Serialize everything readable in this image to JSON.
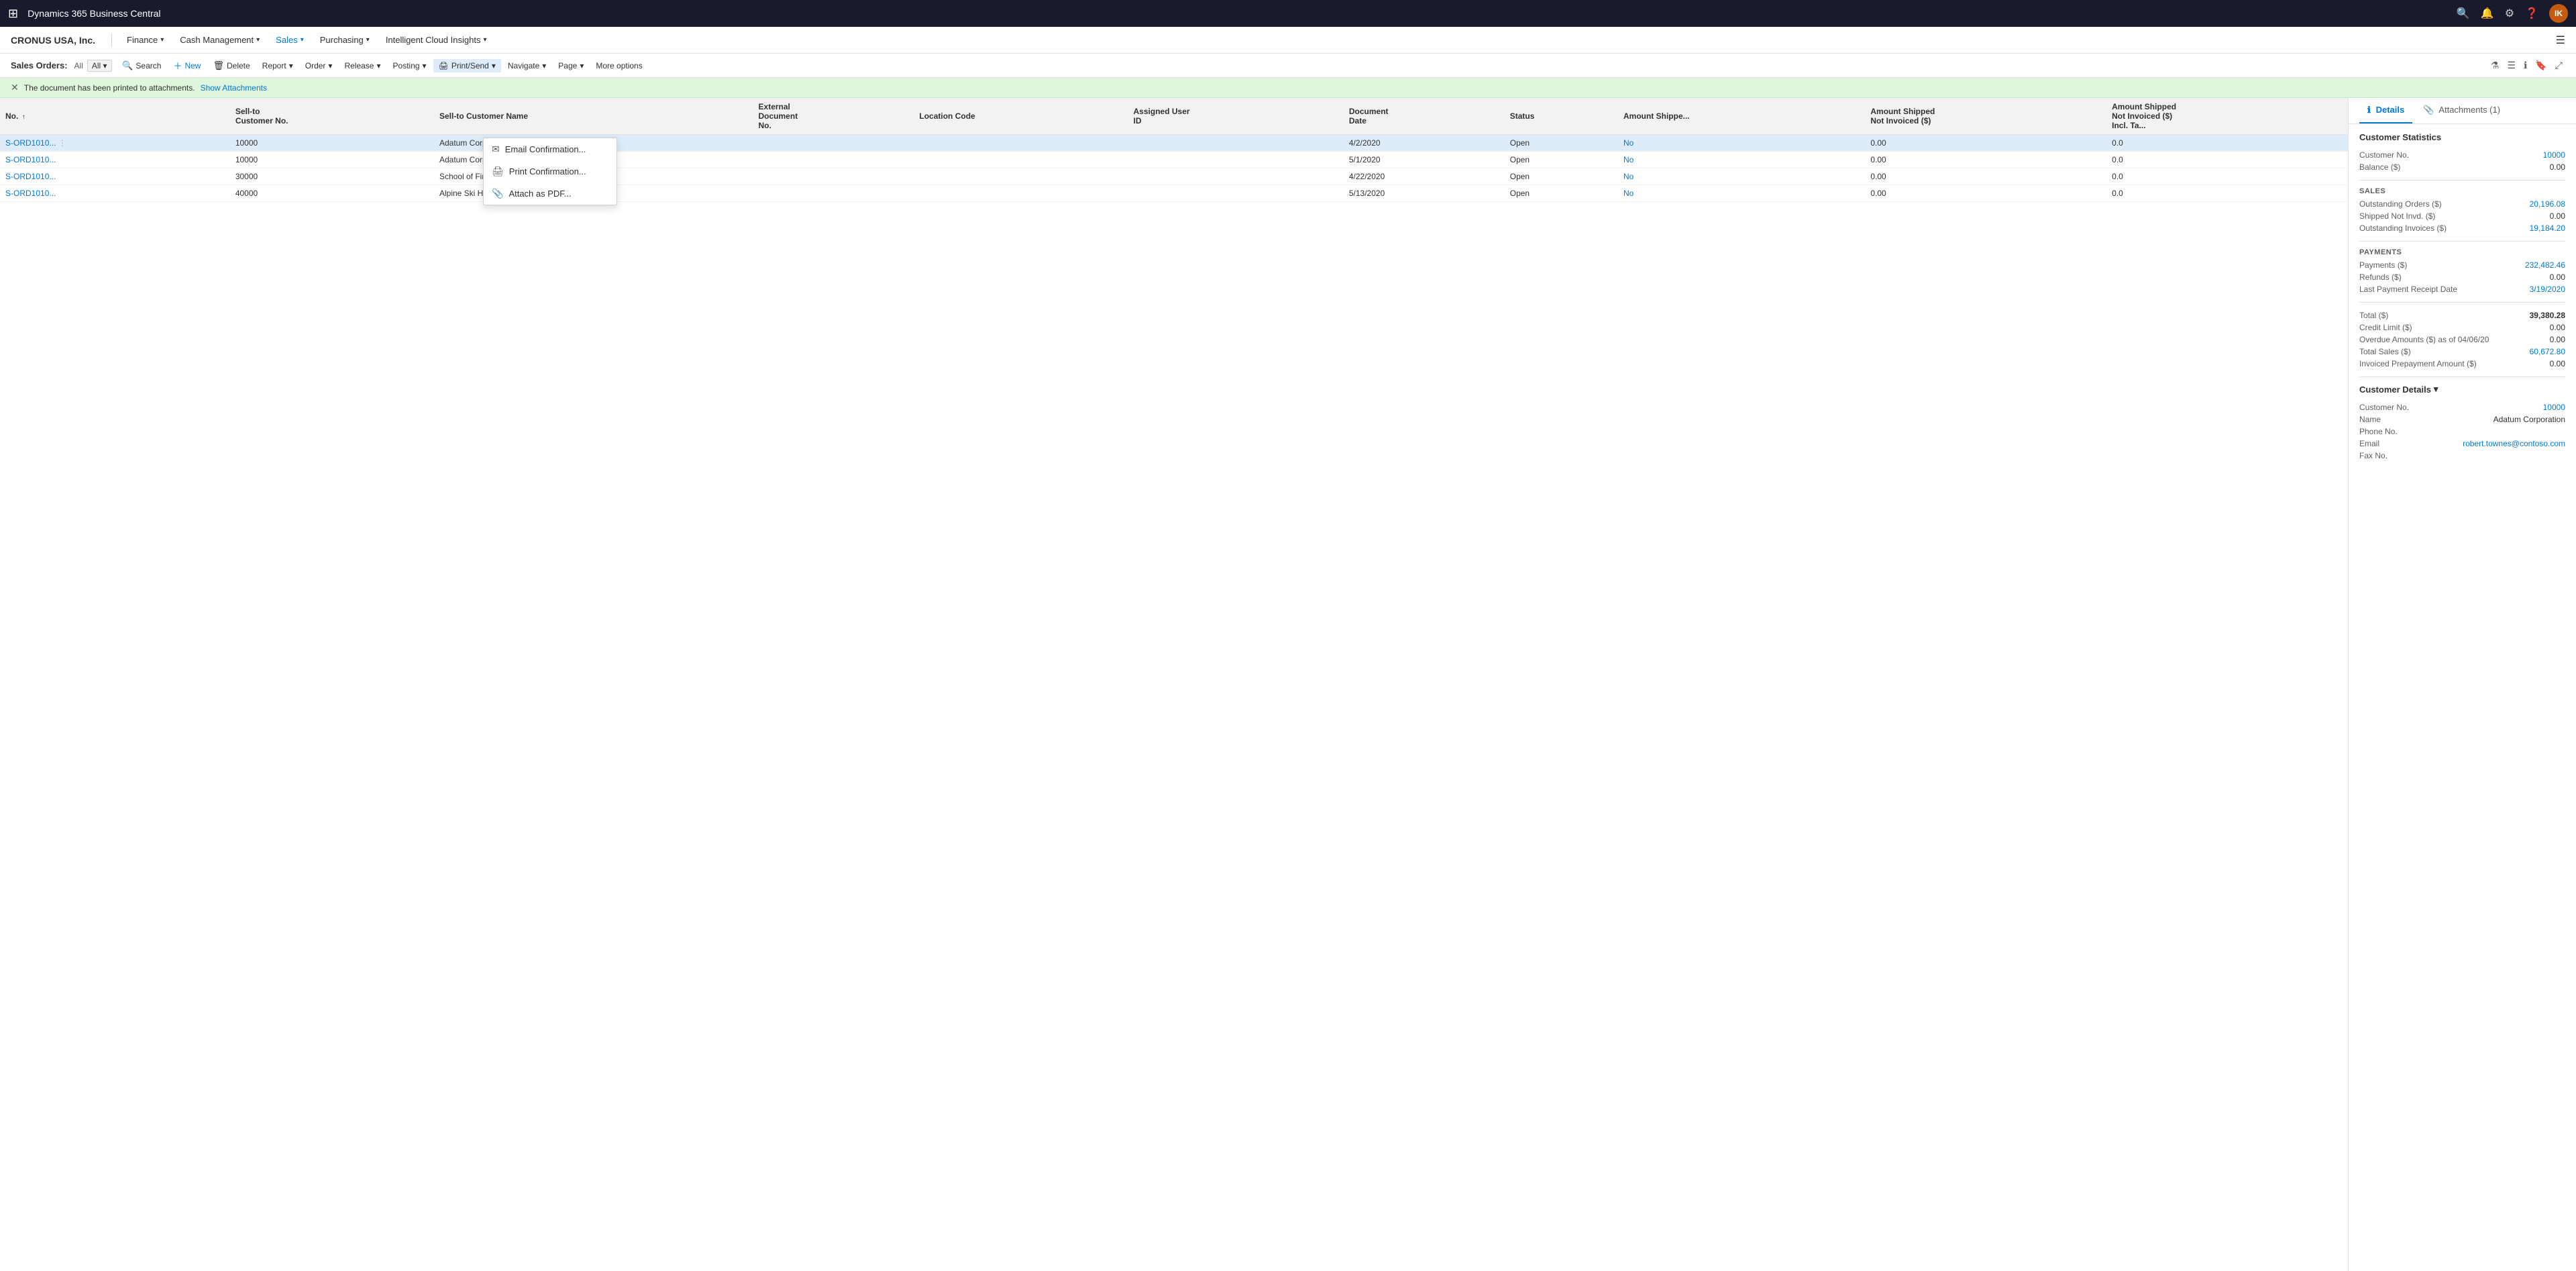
{
  "topBar": {
    "appTitle": "Dynamics 365 Business Central",
    "icons": [
      "search",
      "bell",
      "settings",
      "help"
    ],
    "avatarLabel": "IK"
  },
  "navBar": {
    "companyName": "CRONUS USA, Inc.",
    "items": [
      {
        "label": "Finance",
        "hasChevron": true
      },
      {
        "label": "Cash Management",
        "hasChevron": true
      },
      {
        "label": "Sales",
        "hasChevron": true,
        "active": true
      },
      {
        "label": "Purchasing",
        "hasChevron": true
      },
      {
        "label": "Intelligent Cloud Insights",
        "hasChevron": true
      }
    ]
  },
  "actionBar": {
    "pageLabel": "Sales Orders:",
    "filterLabel": "All",
    "buttons": [
      {
        "icon": "🔍",
        "label": "Search"
      },
      {
        "icon": "＋",
        "label": "New",
        "primary": true
      },
      {
        "icon": "🗑",
        "label": "Delete"
      },
      {
        "icon": "📄",
        "label": "Report",
        "hasChevron": true
      },
      {
        "icon": "📋",
        "label": "Order",
        "hasChevron": true
      },
      {
        "icon": "🚀",
        "label": "Release",
        "hasChevron": true
      },
      {
        "icon": "📮",
        "label": "Posting",
        "hasChevron": true
      },
      {
        "icon": "🖨",
        "label": "Print/Send",
        "hasChevron": true,
        "active": true
      },
      {
        "icon": "🧭",
        "label": "Navigate",
        "hasChevron": true
      },
      {
        "icon": "📄",
        "label": "Page",
        "hasChevron": true
      },
      {
        "icon": "⋯",
        "label": "More options"
      }
    ]
  },
  "notification": {
    "message": "The document has been printed to attachments.",
    "linkLabel": "Show Attachments"
  },
  "table": {
    "columns": [
      {
        "label": "No. ↑"
      },
      {
        "label": "Sell-to Customer No."
      },
      {
        "label": "Sell-to Customer Name"
      },
      {
        "label": "External Document No."
      },
      {
        "label": "Location Code"
      },
      {
        "label": "Assigned User ID"
      },
      {
        "label": "Document Date"
      },
      {
        "label": "Status"
      },
      {
        "label": "Amount Shipped Not Invoiced"
      },
      {
        "label": "Amount Shipped Not Invoiced ($)"
      },
      {
        "label": "Amount Shipped Not Invoiced ($) Incl. Tax"
      }
    ],
    "rows": [
      {
        "no": "S-ORD1010...",
        "custNo": "10000",
        "custName": "Adatum Corporation",
        "extDoc": "",
        "locCode": "",
        "userId": "",
        "docDate": "4/2/2020",
        "status": "Open",
        "amtShipped": "No",
        "val1": "0.00",
        "val2": "0.0",
        "selected": true
      },
      {
        "no": "S-ORD1010...",
        "custNo": "10000",
        "custName": "Adatum Corporation",
        "extDoc": "",
        "locCode": "",
        "userId": "",
        "docDate": "5/1/2020",
        "status": "Open",
        "amtShipped": "No",
        "val1": "0.00",
        "val2": "0.0"
      },
      {
        "no": "S-ORD1010...",
        "custNo": "30000",
        "custName": "School of Fine Art",
        "extDoc": "",
        "locCode": "",
        "userId": "",
        "docDate": "4/22/2020",
        "status": "Open",
        "amtShipped": "No",
        "val1": "0.00",
        "val2": "0.0"
      },
      {
        "no": "S-ORD1010...",
        "custNo": "40000",
        "custName": "Alpine Ski House",
        "extDoc": "",
        "locCode": "",
        "userId": "",
        "docDate": "5/13/2020",
        "status": "Open",
        "amtShipped": "No",
        "val1": "0.00",
        "val2": "0.0"
      }
    ]
  },
  "dropdown": {
    "items": [
      {
        "icon": "✉",
        "label": "Email Confirmation..."
      },
      {
        "icon": "🖨",
        "label": "Print Confirmation..."
      },
      {
        "icon": "📎",
        "label": "Attach as PDF..."
      }
    ]
  },
  "rightPanel": {
    "tabs": [
      {
        "icon": "ℹ",
        "label": "Details",
        "active": true
      },
      {
        "icon": "📎",
        "label": "Attachments (1)"
      }
    ],
    "customerStatistics": {
      "title": "Customer Statistics",
      "fields": [
        {
          "label": "Customer No.",
          "value": "10000",
          "link": true
        },
        {
          "label": "Balance ($)",
          "value": "0.00"
        }
      ],
      "salesSection": {
        "title": "SALES",
        "fields": [
          {
            "label": "Outstanding Orders ($)",
            "value": "20,196.08",
            "link": true
          },
          {
            "label": "Shipped Not Invd. ($)",
            "value": "0.00"
          },
          {
            "label": "Outstanding Invoices ($)",
            "value": "19,184.20",
            "link": true
          }
        ]
      },
      "paymentsSection": {
        "title": "PAYMENTS",
        "fields": [
          {
            "label": "Payments ($)",
            "value": "232,482.46",
            "link": true
          },
          {
            "label": "Refunds ($)",
            "value": "0.00"
          },
          {
            "label": "Last Payment Receipt Date",
            "value": "3/19/2020",
            "link": true
          }
        ]
      },
      "totalFields": [
        {
          "label": "Total ($)",
          "value": "39,380.28",
          "bold": true
        },
        {
          "label": "Credit Limit ($)",
          "value": "0.00"
        },
        {
          "label": "Overdue Amounts ($) as of 04/06/20",
          "value": "0.00"
        },
        {
          "label": "Total Sales ($)",
          "value": "60,672.80",
          "link": true
        },
        {
          "label": "Invoiced Prepayment Amount ($)",
          "value": "0.00"
        }
      ]
    },
    "customerDetails": {
      "title": "Customer Details",
      "fields": [
        {
          "label": "Customer No.",
          "value": "10000",
          "link": true
        },
        {
          "label": "Name",
          "value": "Adatum Corporation"
        },
        {
          "label": "Phone No.",
          "value": ""
        },
        {
          "label": "Email",
          "value": "robert.townes@contoso.com",
          "link": true
        },
        {
          "label": "Fax No.",
          "value": ""
        }
      ]
    }
  }
}
